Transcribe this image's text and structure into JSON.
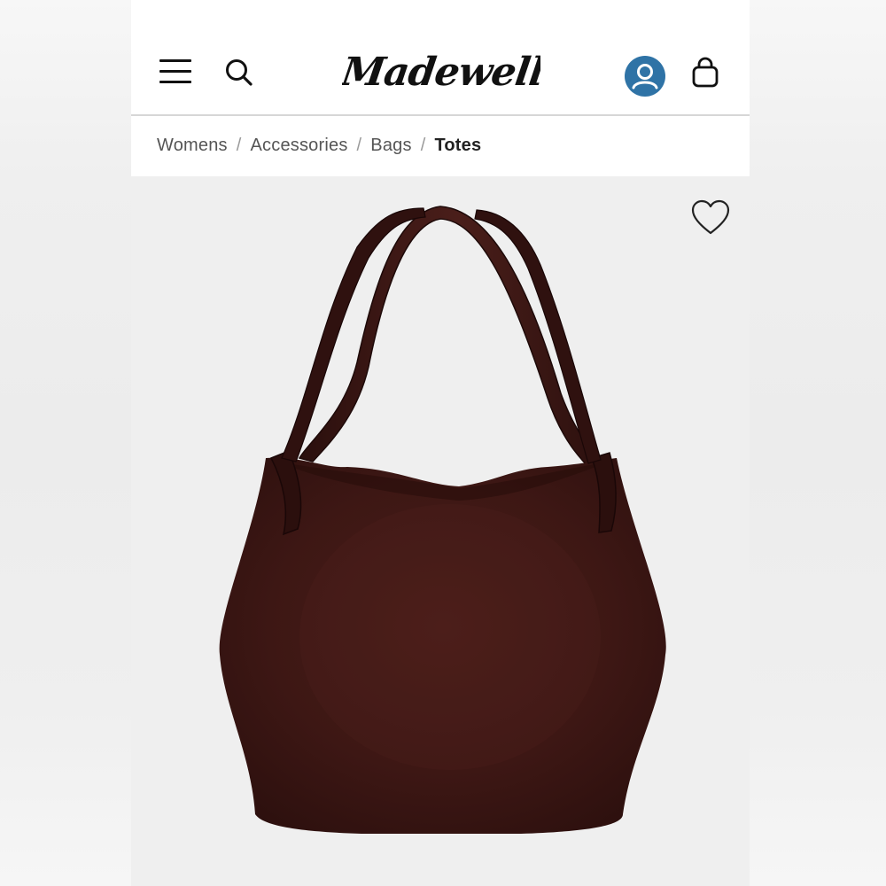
{
  "brand": {
    "logo_text": "Madewell"
  },
  "header": {
    "icons": {
      "menu": "hamburger-menu-icon",
      "search": "search-icon",
      "account": "account-icon",
      "bag": "shopping-bag-icon"
    },
    "colors": {
      "account_accent": "#2f73a6",
      "text": "#111111"
    }
  },
  "breadcrumb": {
    "items": [
      "Womens",
      "Accessories",
      "Bags",
      "Totes"
    ],
    "separator": "/"
  },
  "product": {
    "image_alt": "brown suede tote bag",
    "colors": {
      "suede": "#3d1714",
      "background": "#efefef"
    },
    "wishlist_icon": "heart-icon"
  }
}
